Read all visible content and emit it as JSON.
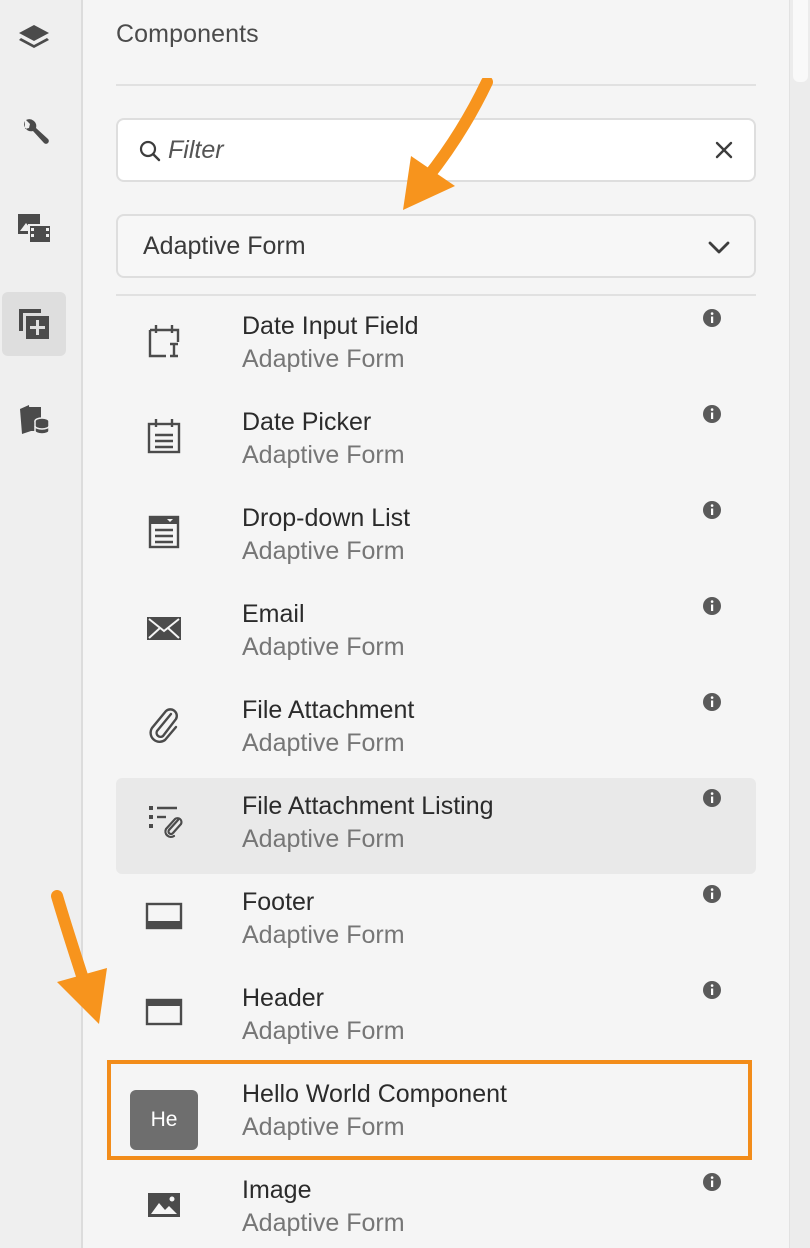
{
  "rail": {
    "items": [
      {
        "icon": "layers-icon"
      },
      {
        "icon": "wrench-icon"
      },
      {
        "icon": "assets-icon"
      },
      {
        "icon": "components-icon",
        "active": true
      },
      {
        "icon": "content-tree-icon"
      }
    ]
  },
  "panel": {
    "title": "Components",
    "filter": {
      "placeholder": "Filter"
    },
    "group_select": {
      "value": "Adaptive Form"
    },
    "components": [
      {
        "name": "Date Input Field",
        "group": "Adaptive Form",
        "icon": "date-input-icon"
      },
      {
        "name": "Date Picker",
        "group": "Adaptive Form",
        "icon": "calendar-icon"
      },
      {
        "name": "Drop-down List",
        "group": "Adaptive Form",
        "icon": "dropdown-list-icon"
      },
      {
        "name": "Email",
        "group": "Adaptive Form",
        "icon": "envelope-icon"
      },
      {
        "name": "File Attachment",
        "group": "Adaptive Form",
        "icon": "paperclip-icon"
      },
      {
        "name": "File Attachment Listing",
        "group": "Adaptive Form",
        "icon": "attachment-list-icon"
      },
      {
        "name": "Footer",
        "group": "Adaptive Form",
        "icon": "footer-icon"
      },
      {
        "name": "Header",
        "group": "Adaptive Form",
        "icon": "header-icon"
      },
      {
        "name": "Hello World Component",
        "group": "Adaptive Form",
        "badge": "He"
      },
      {
        "name": "Image",
        "group": "Adaptive Form",
        "icon": "image-icon"
      }
    ]
  },
  "colors": {
    "accent": "#f28c1a",
    "icon": "#4b4b4b",
    "badge": "#6e6e6e"
  }
}
